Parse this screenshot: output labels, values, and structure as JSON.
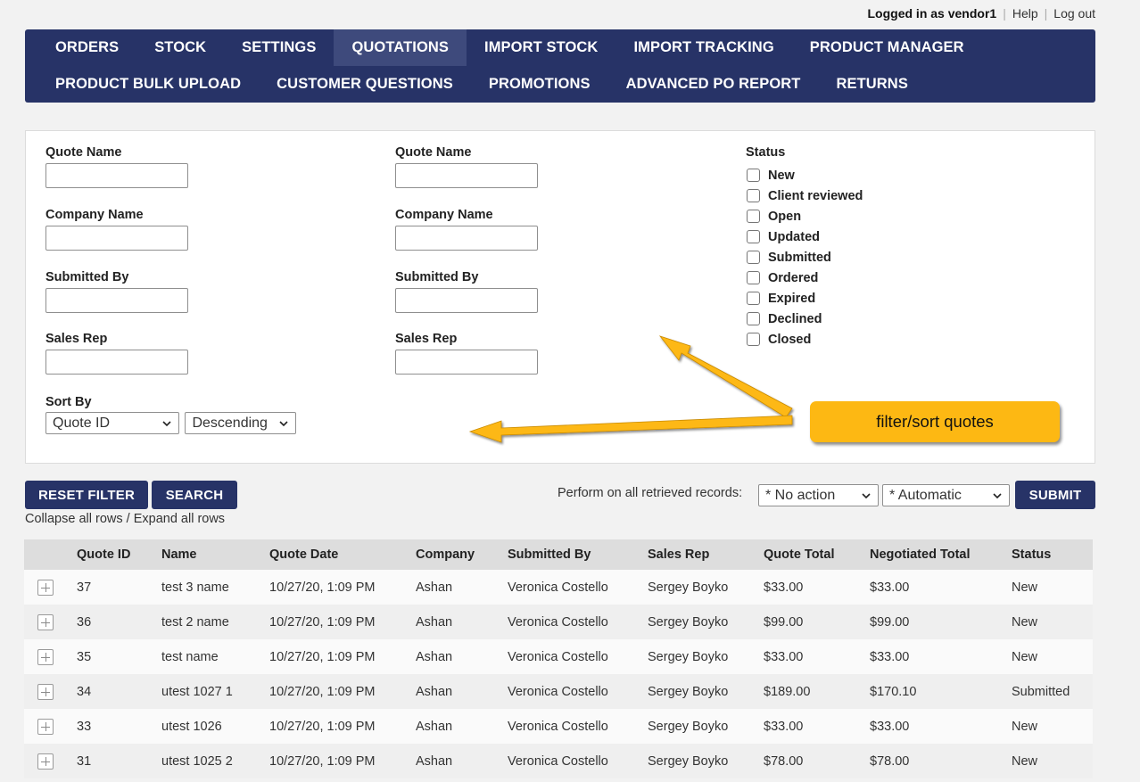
{
  "user": {
    "logged_in": "Logged in as vendor1",
    "help": "Help",
    "logout": "Log out"
  },
  "nav": {
    "row1": [
      "ORDERS",
      "STOCK",
      "SETTINGS",
      "QUOTATIONS",
      "IMPORT STOCK",
      "IMPORT TRACKING",
      "PRODUCT MANAGER"
    ],
    "row2": [
      "PRODUCT BULK UPLOAD",
      "CUSTOMER QUESTIONS",
      "PROMOTIONS",
      "ADVANCED PO REPORT",
      "RETURNS"
    ],
    "active": "QUOTATIONS"
  },
  "filters": {
    "col1": [
      "Quote Name",
      "Company Name",
      "Submitted By",
      "Sales Rep"
    ],
    "col2": [
      "Quote Name",
      "Company Name",
      "Submitted By",
      "Sales Rep"
    ],
    "status_title": "Status",
    "status_options": [
      "New",
      "Client reviewed",
      "Open",
      "Updated",
      "Submitted",
      "Ordered",
      "Expired",
      "Declined",
      "Closed"
    ],
    "sort_by_label": "Sort By",
    "sort_field": "Quote ID",
    "sort_order": "Descending"
  },
  "callout": {
    "text": "filter/sort quotes",
    "color": "#fdb813"
  },
  "actions": {
    "reset": "RESET FILTER",
    "search": "SEARCH",
    "collapse": "Collapse all rows",
    "separator": " / ",
    "expand": "Expand all rows",
    "perform_label": "Perform on all retrieved records:",
    "action_select": "* No action",
    "mode_select": "* Automatic",
    "submit": "SUBMIT"
  },
  "table": {
    "columns": [
      "Quote ID",
      "Name",
      "Quote Date",
      "Company",
      "Submitted By",
      "Sales Rep",
      "Quote Total",
      "Negotiated Total",
      "Status"
    ],
    "rows": [
      [
        "37",
        "test 3 name",
        "10/27/20, 1:09 PM",
        "Ashan",
        "Veronica Costello",
        "Sergey Boyko",
        "$33.00",
        "$33.00",
        "New"
      ],
      [
        "36",
        "test 2 name",
        "10/27/20, 1:09 PM",
        "Ashan",
        "Veronica Costello",
        "Sergey Boyko",
        "$99.00",
        "$99.00",
        "New"
      ],
      [
        "35",
        "test name",
        "10/27/20, 1:09 PM",
        "Ashan",
        "Veronica Costello",
        "Sergey Boyko",
        "$33.00",
        "$33.00",
        "New"
      ],
      [
        "34",
        "utest 1027 1",
        "10/27/20, 1:09 PM",
        "Ashan",
        "Veronica Costello",
        "Sergey Boyko",
        "$189.00",
        "$170.10",
        "Submitted"
      ],
      [
        "33",
        "utest 1026",
        "10/27/20, 1:09 PM",
        "Ashan",
        "Veronica Costello",
        "Sergey Boyko",
        "$33.00",
        "$33.00",
        "New"
      ],
      [
        "31",
        "utest 1025 2",
        "10/27/20, 1:09 PM",
        "Ashan",
        "Veronica Costello",
        "Sergey Boyko",
        "$78.00",
        "$78.00",
        "New"
      ]
    ]
  },
  "colors": {
    "nav_bg": "#273367",
    "nav_active": "#3e4a7c",
    "button_bg": "#273367"
  }
}
